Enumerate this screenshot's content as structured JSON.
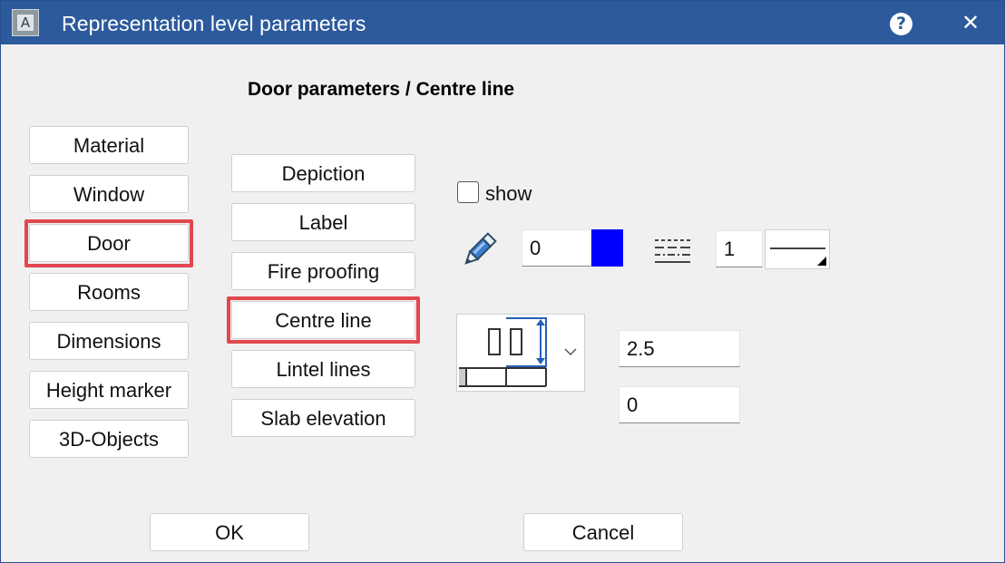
{
  "window": {
    "title": "Representation level parameters",
    "help_glyph": "?",
    "close_glyph": "✕",
    "app_icon_letter": "A"
  },
  "heading": "Door parameters / Centre line",
  "categories": [
    {
      "label": "Material"
    },
    {
      "label": "Window"
    },
    {
      "label": "Door",
      "selected": true
    },
    {
      "label": "Rooms"
    },
    {
      "label": "Dimensions"
    },
    {
      "label": "Height marker"
    },
    {
      "label": "3D-Objects"
    }
  ],
  "subcategories": [
    {
      "label": "Depiction"
    },
    {
      "label": "Label"
    },
    {
      "label": "Fire proofing"
    },
    {
      "label": "Centre line",
      "selected": true
    },
    {
      "label": "Lintel lines"
    },
    {
      "label": "Slab elevation"
    }
  ],
  "options": {
    "show_label": "show",
    "show_checked": false,
    "pen_value": "0",
    "pen_color": "#0000ff",
    "line_value": "1",
    "height_value": "2.5",
    "offset_value": "0"
  },
  "icons": {
    "pen": "pencil-icon",
    "line_type": "dashed-lines-icon",
    "reference": "door-height-reference-icon",
    "dropdown": "chevron-down-icon"
  },
  "footer": {
    "ok_label": "OK",
    "cancel_label": "Cancel"
  },
  "colors": {
    "titlebar": "#2c5a9c",
    "highlight": "#e2474f",
    "swatch": "#0000ff"
  }
}
